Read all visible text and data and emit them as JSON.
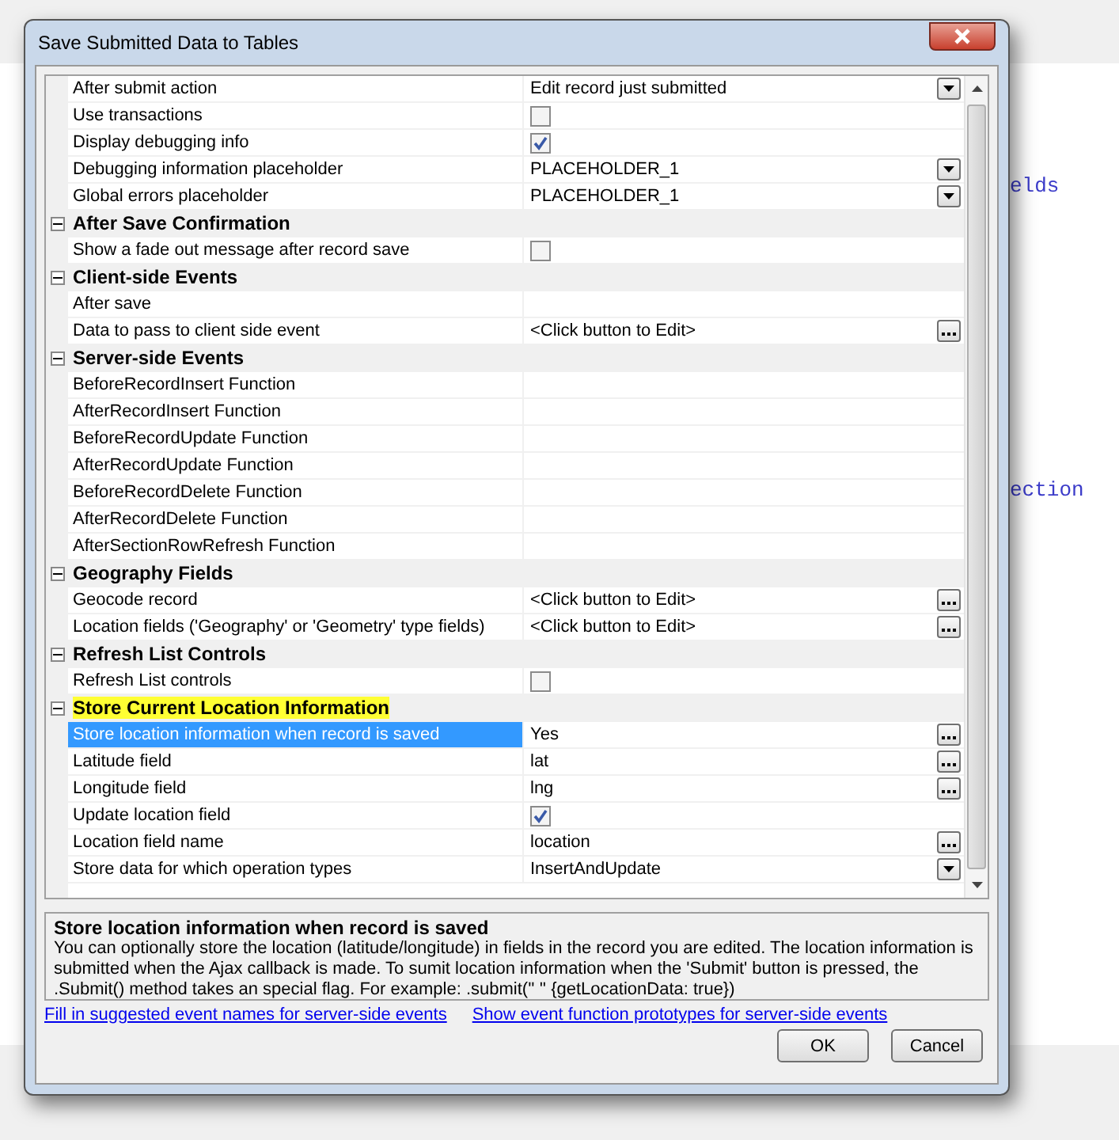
{
  "background": {
    "fragments": [
      "elds",
      "ection"
    ]
  },
  "window": {
    "title": "Save Submitted Data to Tables"
  },
  "property_grid": {
    "rows": [
      {
        "kind": "dropdown",
        "label": "After submit action",
        "value": "Edit record just submitted",
        "selected": false
      },
      {
        "kind": "checkbox",
        "label": "Use transactions",
        "checked": false,
        "selected": false
      },
      {
        "kind": "checkbox",
        "label": "Display debugging info",
        "checked": true,
        "selected": false
      },
      {
        "kind": "dropdown",
        "label": "Debugging information placeholder",
        "value": "PLACEHOLDER_1",
        "selected": false
      },
      {
        "kind": "dropdown",
        "label": "Global errors placeholder",
        "value": "PLACEHOLDER_1",
        "selected": false
      }
    ],
    "categories": [
      {
        "title": "After Save Confirmation",
        "expanded": true,
        "highlighted": false,
        "rows": [
          {
            "kind": "checkbox",
            "label": "Show a fade out message after record save",
            "checked": false,
            "selected": false
          }
        ]
      },
      {
        "title": "Client-side Events",
        "expanded": true,
        "highlighted": false,
        "rows": [
          {
            "kind": "text",
            "label": "After save",
            "selected": false
          },
          {
            "kind": "ellipsis",
            "label": "Data to pass to client side event",
            "value": "<Click button to Edit>",
            "selected": false
          }
        ]
      },
      {
        "title": "Server-side Events",
        "expanded": true,
        "highlighted": false,
        "rows": [
          {
            "kind": "text",
            "label": "BeforeRecordInsert Function",
            "selected": false
          },
          {
            "kind": "text",
            "label": "AfterRecordInsert Function",
            "selected": false
          },
          {
            "kind": "text",
            "label": "BeforeRecordUpdate Function",
            "selected": false
          },
          {
            "kind": "text",
            "label": "AfterRecordUpdate Function",
            "selected": false
          },
          {
            "kind": "text",
            "label": "BeforeRecordDelete Function",
            "selected": false
          },
          {
            "kind": "text",
            "label": "AfterRecordDelete Function",
            "selected": false
          },
          {
            "kind": "text",
            "label": "AfterSectionRowRefresh Function",
            "selected": false
          }
        ]
      },
      {
        "title": "Geography Fields",
        "expanded": true,
        "highlighted": false,
        "rows": [
          {
            "kind": "ellipsis",
            "label": "Geocode record",
            "value": "<Click button to Edit>",
            "selected": false
          },
          {
            "kind": "ellipsis",
            "label": "Location fields ('Geography' or 'Geometry' type fields)",
            "value": "<Click button to Edit>",
            "selected": false
          }
        ]
      },
      {
        "title": "Refresh List Controls",
        "expanded": true,
        "highlighted": false,
        "rows": [
          {
            "kind": "checkbox",
            "label": "Refresh List controls",
            "checked": false,
            "selected": false
          }
        ]
      },
      {
        "title": "Store Current Location Information",
        "expanded": true,
        "highlighted": true,
        "rows": [
          {
            "kind": "ellipsis",
            "label": "Store location information when record is saved",
            "value": "Yes",
            "selected": true
          },
          {
            "kind": "ellipsis",
            "label": "Latitude field",
            "value": "lat",
            "selected": false
          },
          {
            "kind": "ellipsis",
            "label": "Longitude field",
            "value": "lng",
            "selected": false
          },
          {
            "kind": "checkbox",
            "label": "Update location field",
            "checked": true,
            "selected": false
          },
          {
            "kind": "ellipsis",
            "label": "Location field name",
            "value": "location",
            "selected": false
          },
          {
            "kind": "dropdown",
            "label": "Store data for which operation types",
            "value": "InsertAndUpdate",
            "selected": false
          }
        ]
      }
    ]
  },
  "description": {
    "title": "Store location information when record is saved",
    "text": "You can optionally store the location (latitude/longitude) in fields in the record you are edited. The location information is submitted when the Ajax callback is made. To sumit location information when the 'Submit' button is pressed, the .Submit() method takes an special flag. For example: .submit('' '' {getLocationData: true})"
  },
  "links": [
    "Fill in suggested event names for server-side events",
    "Show event function prototypes for server-side events"
  ],
  "buttons": [
    "OK",
    "Cancel"
  ]
}
